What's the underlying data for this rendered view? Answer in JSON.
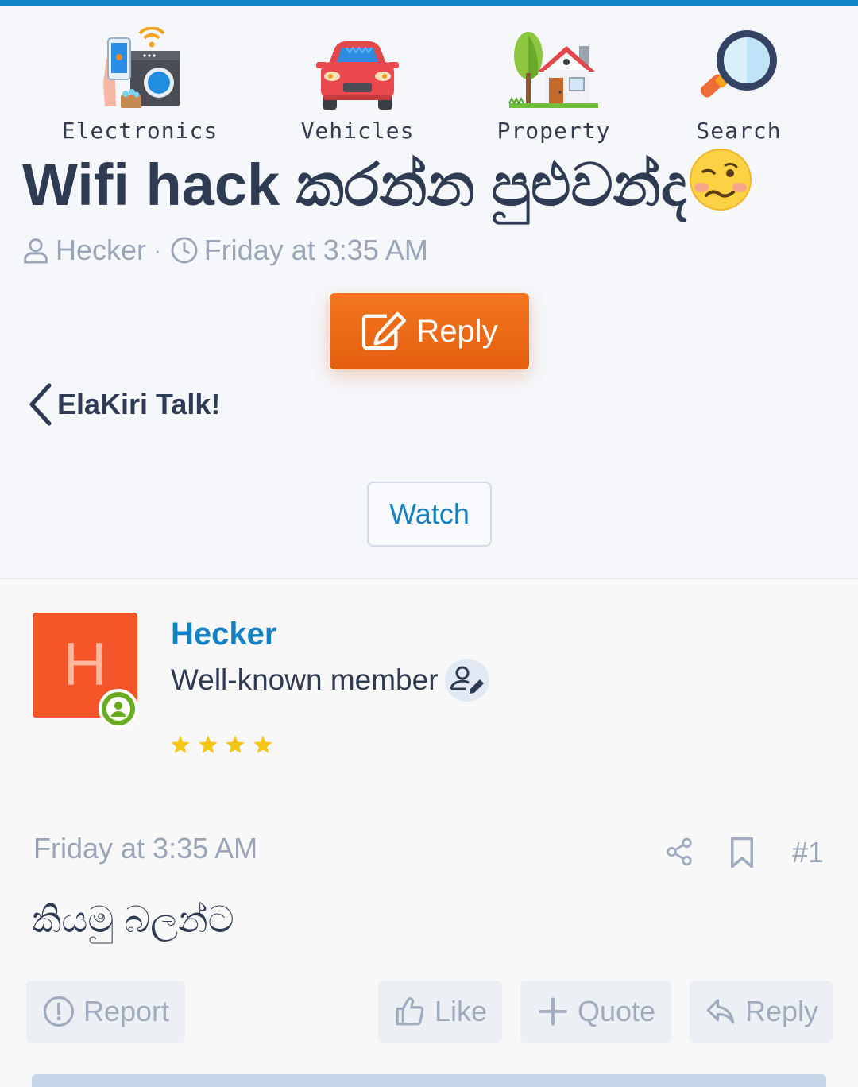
{
  "categories": [
    {
      "label": "Electronics",
      "icon": "electronics-icon"
    },
    {
      "label": "Vehicles",
      "icon": "car-icon"
    },
    {
      "label": "Property",
      "icon": "house-icon"
    },
    {
      "label": "Search",
      "icon": "magnifier-icon"
    }
  ],
  "thread": {
    "title": "Wifi hack කරන්න පුළුවන්ද",
    "title_emoji": "woozy-face-emoji",
    "author": "Hecker",
    "separator": "·",
    "date": "Friday at 3:35 AM"
  },
  "actions": {
    "reply_label": "Reply",
    "back_label": "ElaKiri Talk!",
    "watch_label": "Watch"
  },
  "post": {
    "avatar_letter": "H",
    "username": "Hecker",
    "user_title": "Well-known member",
    "star_count": 4,
    "date": "Friday at 3:35 AM",
    "number": "#1",
    "body": "කියමු බලන්ට",
    "report_label": "Report",
    "like_label": "Like",
    "quote_label": "Quote",
    "reply_label": "Reply"
  },
  "colors": {
    "accent": "#1284c8",
    "reply_button": "#e8651a",
    "avatar_bg": "#f4562a",
    "online": "#6aac1f",
    "star": "#f5c518"
  }
}
